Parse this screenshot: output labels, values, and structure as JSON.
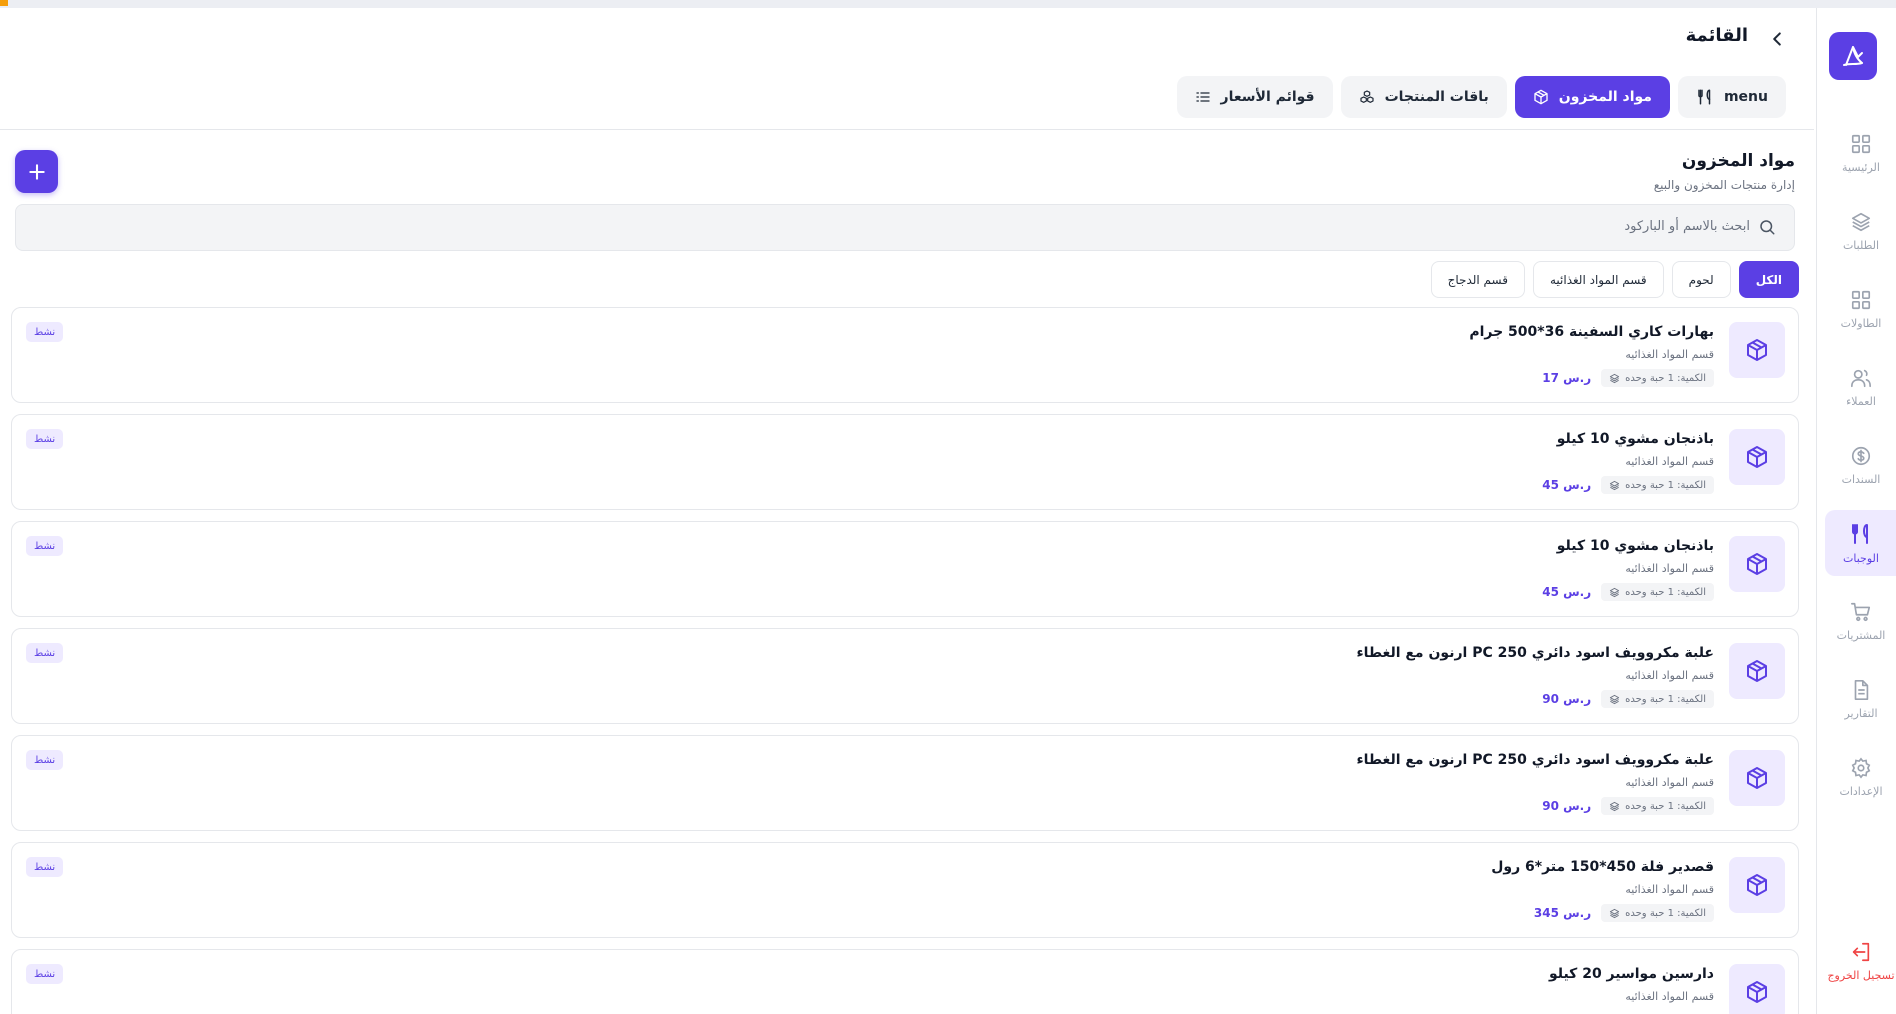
{
  "header": {
    "title": "القائمة",
    "tabs": [
      {
        "label": "menu",
        "icon": "utensils-icon",
        "active": false
      },
      {
        "label": "مواد المخزون",
        "icon": "box-icon",
        "active": true
      },
      {
        "label": "باقات المنتجات",
        "icon": "boxes-icon",
        "active": false
      },
      {
        "label": "قوائم الأسعار",
        "icon": "list-icon",
        "active": false
      }
    ]
  },
  "sidebar": {
    "items": [
      {
        "label": "الرئيسية",
        "icon": "dashboard-icon"
      },
      {
        "label": "الطلبات",
        "icon": "layers-icon"
      },
      {
        "label": "الطاولات",
        "icon": "grid-icon"
      },
      {
        "label": "العملاء",
        "icon": "users-icon"
      },
      {
        "label": "السندات",
        "icon": "dollar-circle-icon"
      },
      {
        "label": "الوجبات",
        "icon": "utensils-icon",
        "active": true
      },
      {
        "label": "المشتريات",
        "icon": "cart-icon"
      },
      {
        "label": "التقارير",
        "icon": "file-text-icon"
      },
      {
        "label": "الإعدادات",
        "icon": "gear-icon"
      }
    ],
    "logout_label": "تسجيل الخروج"
  },
  "section": {
    "title": "مواد المخزون",
    "subtitle": "إدارة منتجات المخزون والبيع"
  },
  "search": {
    "placeholder": "ابحث بالاسم أو الباركود"
  },
  "filters": [
    {
      "label": "الكل",
      "active": true
    },
    {
      "label": "لحوم",
      "active": false
    },
    {
      "label": "قسم المواد الغذائيه",
      "active": false
    },
    {
      "label": "قسم الدجاج",
      "active": false
    }
  ],
  "products": [
    {
      "name": "بهارات كاري السفينة 36*500 جرام",
      "category": "قسم المواد الغذائيه",
      "price": "17 ر.س",
      "qty": "الكمية: 1 حبة وحده",
      "status": "نشط"
    },
    {
      "name": "باذنجان مشوي 10 كيلو",
      "category": "قسم المواد الغذائيه",
      "price": "45 ر.س",
      "qty": "الكمية: 1 حبة وحده",
      "status": "نشط"
    },
    {
      "name": "باذنجان مشوي 10 كيلو",
      "category": "قسم المواد الغذائيه",
      "price": "45 ر.س",
      "qty": "الكمية: 1 حبة وحده",
      "status": "نشط"
    },
    {
      "name": "ارنون مع الغطاء PC علبة مكروويف اسود دائري 250",
      "category": "قسم المواد الغذائيه",
      "price": "90 ر.س",
      "qty": "الكمية: 1 حبة وحده",
      "status": "نشط"
    },
    {
      "name": "ارنون مع الغطاء PC علبة مكروويف اسود دائري 250",
      "category": "قسم المواد الغذائيه",
      "price": "90 ر.س",
      "qty": "الكمية: 1 حبة وحده",
      "status": "نشط"
    },
    {
      "name": "قصدير فلة 450*150 متر*6 رول",
      "category": "قسم المواد الغذائيه",
      "price": "345 ر.س",
      "qty": "الكمية: 1 حبة وحده",
      "status": "نشط"
    },
    {
      "name": "دارسين مواسير 20 كيلو",
      "category": "قسم المواد الغذائيه",
      "price": "",
      "qty": "",
      "status": "نشط"
    }
  ],
  "colors": {
    "accent": "#5b3fe4",
    "accent_soft": "#eeeaff",
    "danger": "#ef4444"
  }
}
